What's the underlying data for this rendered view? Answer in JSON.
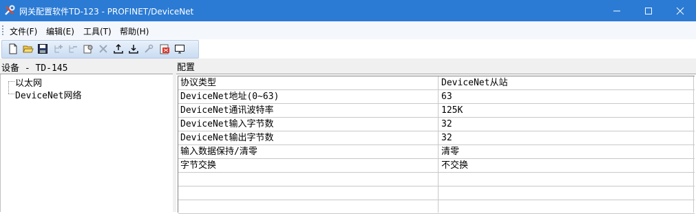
{
  "window": {
    "title": "网关配置软件TD-123 - PROFINET/DeviceNet"
  },
  "menu": [
    {
      "label": "文件(F)"
    },
    {
      "label": "编辑(E)"
    },
    {
      "label": "工具(T)"
    },
    {
      "label": "帮助(H)"
    }
  ],
  "toolbar": {
    "icons": [
      "new-file-icon",
      "open-folder-icon",
      "save-icon",
      "add-node-icon",
      "remove-node-icon",
      "properties-icon",
      "delete-icon",
      "upload-icon",
      "download-icon",
      "tools-icon",
      "export-pdf-icon",
      "monitor-icon"
    ]
  },
  "left_panel": {
    "header": "设备 - TD-145",
    "tree": [
      {
        "label": "以太网"
      },
      {
        "label": "DeviceNet网络"
      }
    ]
  },
  "right_panel": {
    "header": "配置",
    "rows": [
      {
        "key": "协议类型",
        "value": "DeviceNet从站"
      },
      {
        "key": "DeviceNet地址(0~63)",
        "value": "63"
      },
      {
        "key": "DeviceNet通讯波特率",
        "value": "125K"
      },
      {
        "key": "DeviceNet输入字节数",
        "value": "32"
      },
      {
        "key": "DeviceNet输出字节数",
        "value": "32"
      },
      {
        "key": "输入数据保持/清零",
        "value": "清零"
      },
      {
        "key": "字节交换",
        "value": "不交换"
      },
      {
        "key": "",
        "value": ""
      },
      {
        "key": "",
        "value": ""
      },
      {
        "key": "",
        "value": ""
      }
    ]
  }
}
